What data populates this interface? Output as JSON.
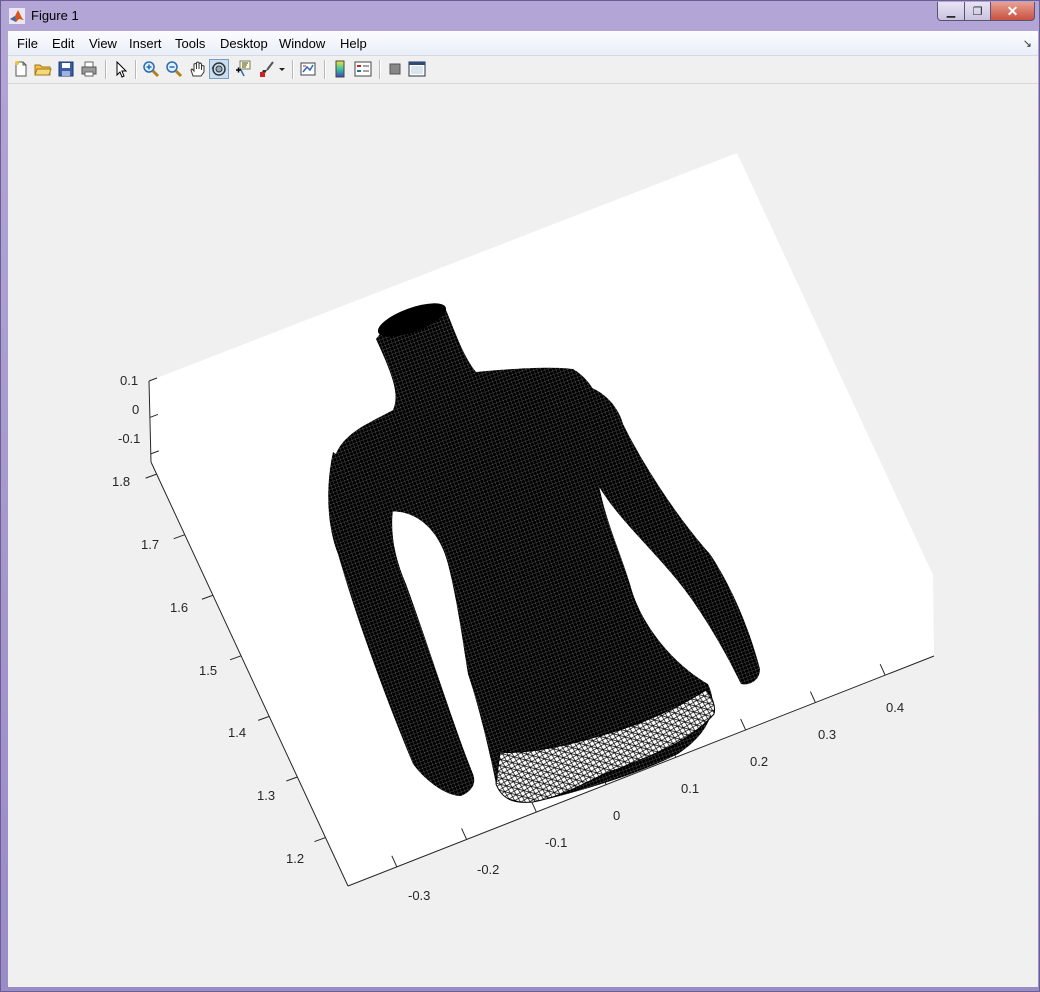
{
  "window": {
    "title": "Figure 1",
    "min_symbol": "▁",
    "max_symbol": "❐",
    "close_symbol": "✕"
  },
  "menubar": {
    "items": [
      "File",
      "Edit",
      "View",
      "Insert",
      "Tools",
      "Desktop",
      "Window",
      "Help"
    ],
    "expand_icon": "↘"
  },
  "toolbar": {
    "buttons": [
      "new-figure-icon",
      "open-file-icon",
      "save-icon",
      "print-icon",
      "pointer-icon",
      "zoom-in-icon",
      "zoom-out-icon",
      "pan-icon",
      "rotate-3d-icon",
      "data-cursor-icon",
      "brush-icon",
      "link-plot-icon",
      "colorbar-icon",
      "legend-icon",
      "hide-plot-tools-icon",
      "show-plot-tools-icon"
    ],
    "active": "rotate-3d-icon"
  },
  "axes": {
    "z_ticks": [
      "0.1",
      "0",
      "-0.1"
    ],
    "y_ticks": [
      "1.8",
      "1.7",
      "1.6",
      "1.5",
      "1.4",
      "1.3",
      "1.2"
    ],
    "x_ticks": [
      "-0.3",
      "-0.2",
      "-0.1",
      "0",
      "0.1",
      "0.2",
      "0.3",
      "0.4"
    ]
  },
  "plot": {
    "type": "3d-wireframe-mesh",
    "subject": "human torso with arms",
    "mesh_color": "#000000",
    "background": "#ffffff"
  }
}
